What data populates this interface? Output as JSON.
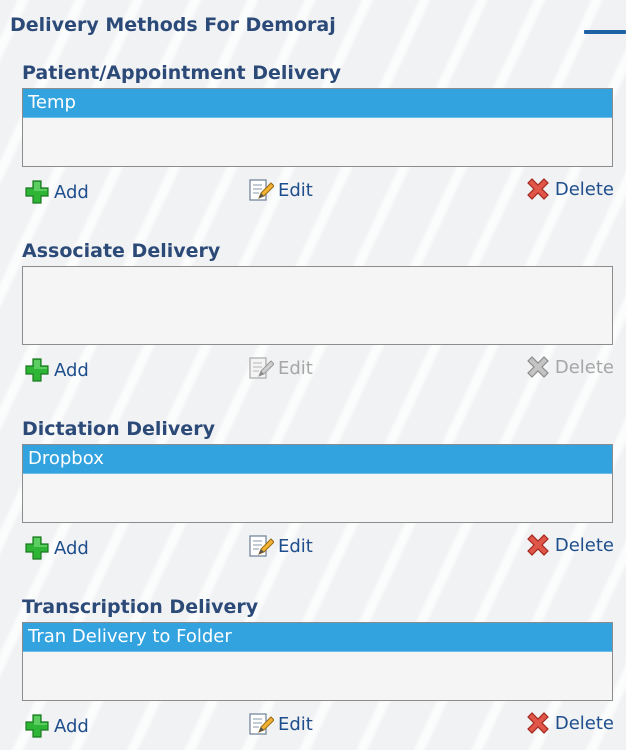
{
  "panel": {
    "title": "Delivery Methods For Demoraj"
  },
  "sections": [
    {
      "title": "Patient/Appointment Delivery",
      "items": [
        "Temp"
      ],
      "add_label": "Add",
      "edit_label": "Edit",
      "delete_label": "Delete",
      "edit_enabled": true,
      "delete_enabled": true
    },
    {
      "title": "Associate Delivery",
      "items": [],
      "add_label": "Add",
      "edit_label": "Edit",
      "delete_label": "Delete",
      "edit_enabled": false,
      "delete_enabled": false
    },
    {
      "title": "Dictation Delivery",
      "items": [
        "Dropbox"
      ],
      "add_label": "Add",
      "edit_label": "Edit",
      "delete_label": "Delete",
      "edit_enabled": true,
      "delete_enabled": true
    },
    {
      "title": "Transcription Delivery",
      "items": [
        "Tran Delivery to Folder"
      ],
      "add_label": "Add",
      "edit_label": "Edit",
      "delete_label": "Delete",
      "edit_enabled": true,
      "delete_enabled": true
    }
  ],
  "icons": {
    "add": "green-plus-icon",
    "edit": "edit-pencil-icon",
    "delete": "red-x-icon",
    "collapse": "minimize-bar-icon"
  },
  "colors": {
    "heading": "#2c4a78",
    "link": "#1f4e8c",
    "selected_row": "#33a3e0",
    "disabled": "#a6a6a6",
    "collapse_bar": "#1e62a6"
  }
}
